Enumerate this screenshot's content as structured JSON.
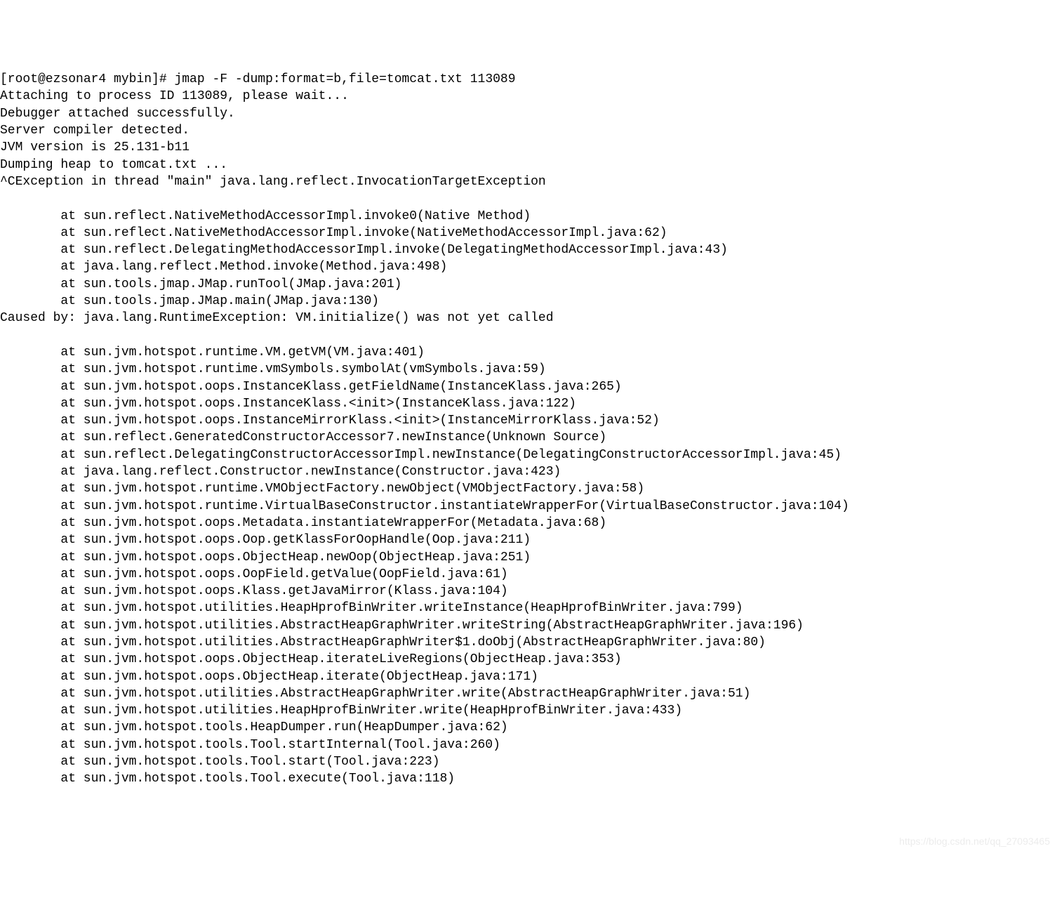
{
  "terminal": {
    "prompt": "[root@ezsonar4 mybin]# ",
    "command": "jmap -F -dump:format=b,file=tomcat.txt 113089",
    "lines_pre": [
      "Attaching to process ID 113089, please wait...",
      "Debugger attached successfully.",
      "Server compiler detected.",
      "JVM version is 25.131-b11",
      "Dumping heap to tomcat.txt ..."
    ],
    "exception_header": "^CException in thread \"main\" java.lang.reflect.InvocationTargetException",
    "stack1": [
      "at sun.reflect.NativeMethodAccessorImpl.invoke0(Native Method)",
      "at sun.reflect.NativeMethodAccessorImpl.invoke(NativeMethodAccessorImpl.java:62)",
      "at sun.reflect.DelegatingMethodAccessorImpl.invoke(DelegatingMethodAccessorImpl.java:43)",
      "at java.lang.reflect.Method.invoke(Method.java:498)",
      "at sun.tools.jmap.JMap.runTool(JMap.java:201)",
      "at sun.tools.jmap.JMap.main(JMap.java:130)"
    ],
    "caused_by": "Caused by: java.lang.RuntimeException: VM.initialize() was not yet called",
    "stack2": [
      "at sun.jvm.hotspot.runtime.VM.getVM(VM.java:401)",
      "at sun.jvm.hotspot.runtime.vmSymbols.symbolAt(vmSymbols.java:59)",
      "at sun.jvm.hotspot.oops.InstanceKlass.getFieldName(InstanceKlass.java:265)",
      "at sun.jvm.hotspot.oops.InstanceKlass.<init>(InstanceKlass.java:122)",
      "at sun.jvm.hotspot.oops.InstanceMirrorKlass.<init>(InstanceMirrorKlass.java:52)",
      "at sun.reflect.GeneratedConstructorAccessor7.newInstance(Unknown Source)",
      "at sun.reflect.DelegatingConstructorAccessorImpl.newInstance(DelegatingConstructorAccessorImpl.java:45)",
      "at java.lang.reflect.Constructor.newInstance(Constructor.java:423)",
      "at sun.jvm.hotspot.runtime.VMObjectFactory.newObject(VMObjectFactory.java:58)",
      "at sun.jvm.hotspot.runtime.VirtualBaseConstructor.instantiateWrapperFor(VirtualBaseConstructor.java:104)",
      "at sun.jvm.hotspot.oops.Metadata.instantiateWrapperFor(Metadata.java:68)",
      "at sun.jvm.hotspot.oops.Oop.getKlassForOopHandle(Oop.java:211)",
      "at sun.jvm.hotspot.oops.ObjectHeap.newOop(ObjectHeap.java:251)",
      "at sun.jvm.hotspot.oops.OopField.getValue(OopField.java:61)",
      "at sun.jvm.hotspot.oops.Klass.getJavaMirror(Klass.java:104)",
      "at sun.jvm.hotspot.utilities.HeapHprofBinWriter.writeInstance(HeapHprofBinWriter.java:799)",
      "at sun.jvm.hotspot.utilities.AbstractHeapGraphWriter.writeString(AbstractHeapGraphWriter.java:196)",
      "at sun.jvm.hotspot.utilities.AbstractHeapGraphWriter$1.doObj(AbstractHeapGraphWriter.java:80)",
      "at sun.jvm.hotspot.oops.ObjectHeap.iterateLiveRegions(ObjectHeap.java:353)",
      "at sun.jvm.hotspot.oops.ObjectHeap.iterate(ObjectHeap.java:171)",
      "at sun.jvm.hotspot.utilities.AbstractHeapGraphWriter.write(AbstractHeapGraphWriter.java:51)",
      "at sun.jvm.hotspot.utilities.HeapHprofBinWriter.write(HeapHprofBinWriter.java:433)",
      "at sun.jvm.hotspot.tools.HeapDumper.run(HeapDumper.java:62)",
      "at sun.jvm.hotspot.tools.Tool.startInternal(Tool.java:260)",
      "at sun.jvm.hotspot.tools.Tool.start(Tool.java:223)",
      "at sun.jvm.hotspot.tools.Tool.execute(Tool.java:118)"
    ],
    "watermark": "https://blog.csdn.net/qq_27093465"
  }
}
